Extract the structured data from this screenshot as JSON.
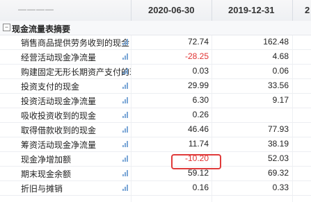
{
  "header": {
    "cut_label": "————",
    "col1": "2020-06-30",
    "col2": "2019-12-31",
    "col3_partial": "2"
  },
  "section": {
    "toggle": "−",
    "title": "现金流量表摘要"
  },
  "rows": [
    {
      "name": "销售商品提供劳务收到的现金",
      "v1": "72.74",
      "v2": "162.48",
      "neg": false
    },
    {
      "name": "经营活动现金净流量",
      "v1": "-28.25",
      "v2": "4.68",
      "neg": true
    },
    {
      "name": "购建固定无形长期资产支付的现金",
      "v1": "0.03",
      "v2": "0.06",
      "neg": false
    },
    {
      "name": "投资支付的现金",
      "v1": "29.99",
      "v2": "33.56",
      "neg": false
    },
    {
      "name": "投资活动现金净流量",
      "v1": "6.30",
      "v2": "9.17",
      "neg": false
    },
    {
      "name": "吸收投资收到的现金",
      "v1": "0.26",
      "v2": "",
      "neg": false
    },
    {
      "name": "取得借款收到的现金",
      "v1": "46.46",
      "v2": "77.93",
      "neg": false
    },
    {
      "name": "筹资活动现金净流量",
      "v1": "11.74",
      "v2": "38.19",
      "neg": false
    },
    {
      "name": "现金净增加额",
      "v1": "-10.20",
      "v2": "52.03",
      "neg": true
    },
    {
      "name": "期末现金余额",
      "v1": "59.12",
      "v2": "69.32",
      "neg": false
    },
    {
      "name": "折旧与摊销",
      "v1": "0.16",
      "v2": "0.33",
      "neg": false
    }
  ],
  "colors": {
    "negative": "#e03131",
    "highlight_border": "#e03b3b",
    "chart_icon": "#7aa6d6"
  }
}
